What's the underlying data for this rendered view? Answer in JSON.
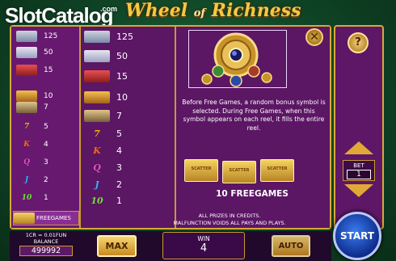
{
  "brand": {
    "watermark_slot": "Slot",
    "watermark_catalog": "Catalog",
    "watermark_com": ".com"
  },
  "title": {
    "word1": "Wheel",
    "of": "of",
    "word2": "Richness"
  },
  "paytable": {
    "left_rows": [
      {
        "symbol": "gold-bars",
        "payout": "125"
      },
      {
        "symbol": "piggy-bank",
        "payout": "50"
      },
      {
        "symbol": "red-car",
        "payout": "15"
      },
      {
        "symbol": "coins",
        "payout": "10"
      },
      {
        "symbol": "banknotes",
        "payout": "7"
      },
      {
        "symbol": "seven",
        "glyph": "7",
        "payout": "5"
      },
      {
        "symbol": "king",
        "glyph": "K",
        "payout": "4"
      },
      {
        "symbol": "queen",
        "glyph": "Q",
        "payout": "3"
      },
      {
        "symbol": "jack",
        "glyph": "J",
        "payout": "2"
      },
      {
        "symbol": "ten",
        "glyph": "10",
        "payout": "1"
      }
    ],
    "freegames_label": "FREEGAMES",
    "mid_rows": [
      {
        "symbol": "gold-bars",
        "payout": "125"
      },
      {
        "symbol": "piggy-bank",
        "payout": "50"
      },
      {
        "symbol": "red-car",
        "payout": "15"
      },
      {
        "symbol": "coins",
        "payout": "10"
      },
      {
        "symbol": "banknotes",
        "payout": "7"
      },
      {
        "symbol": "seven",
        "glyph": "7",
        "payout": "5"
      },
      {
        "symbol": "king",
        "glyph": "K",
        "payout": "4"
      },
      {
        "symbol": "queen",
        "glyph": "Q",
        "payout": "3"
      },
      {
        "symbol": "jack",
        "glyph": "J",
        "payout": "2"
      },
      {
        "symbol": "ten",
        "glyph": "10",
        "payout": "1"
      }
    ],
    "description": "Before Free Games, a random bonus symbol is selected. During Free Games, when this symbol appears on each reel, it fills the entire reel.",
    "scatter_text": "SCATTER",
    "freegames_count": "10 FREEGAMES",
    "footer_line1": "ALL PRIZES IN CREDITS.",
    "footer_line2": "MALFUNCTION VOIDS ALL PAYS AND PLAYS."
  },
  "controls": {
    "close_glyph": "✕",
    "help_glyph": "?",
    "bet_label": "BET",
    "bet_value": "1",
    "start_label": "START",
    "max_label": "MAX",
    "auto_label": "AUTO",
    "denomination": "1CR = 0.01FUN",
    "balance_label": "BALANCE",
    "balance_value": "499992",
    "win_label": "WIN",
    "win_value": "4"
  },
  "colors": {
    "frame_gold": "#d7a83a",
    "panel_purple": "#5b1664",
    "start_blue": "#1e4fc8"
  }
}
